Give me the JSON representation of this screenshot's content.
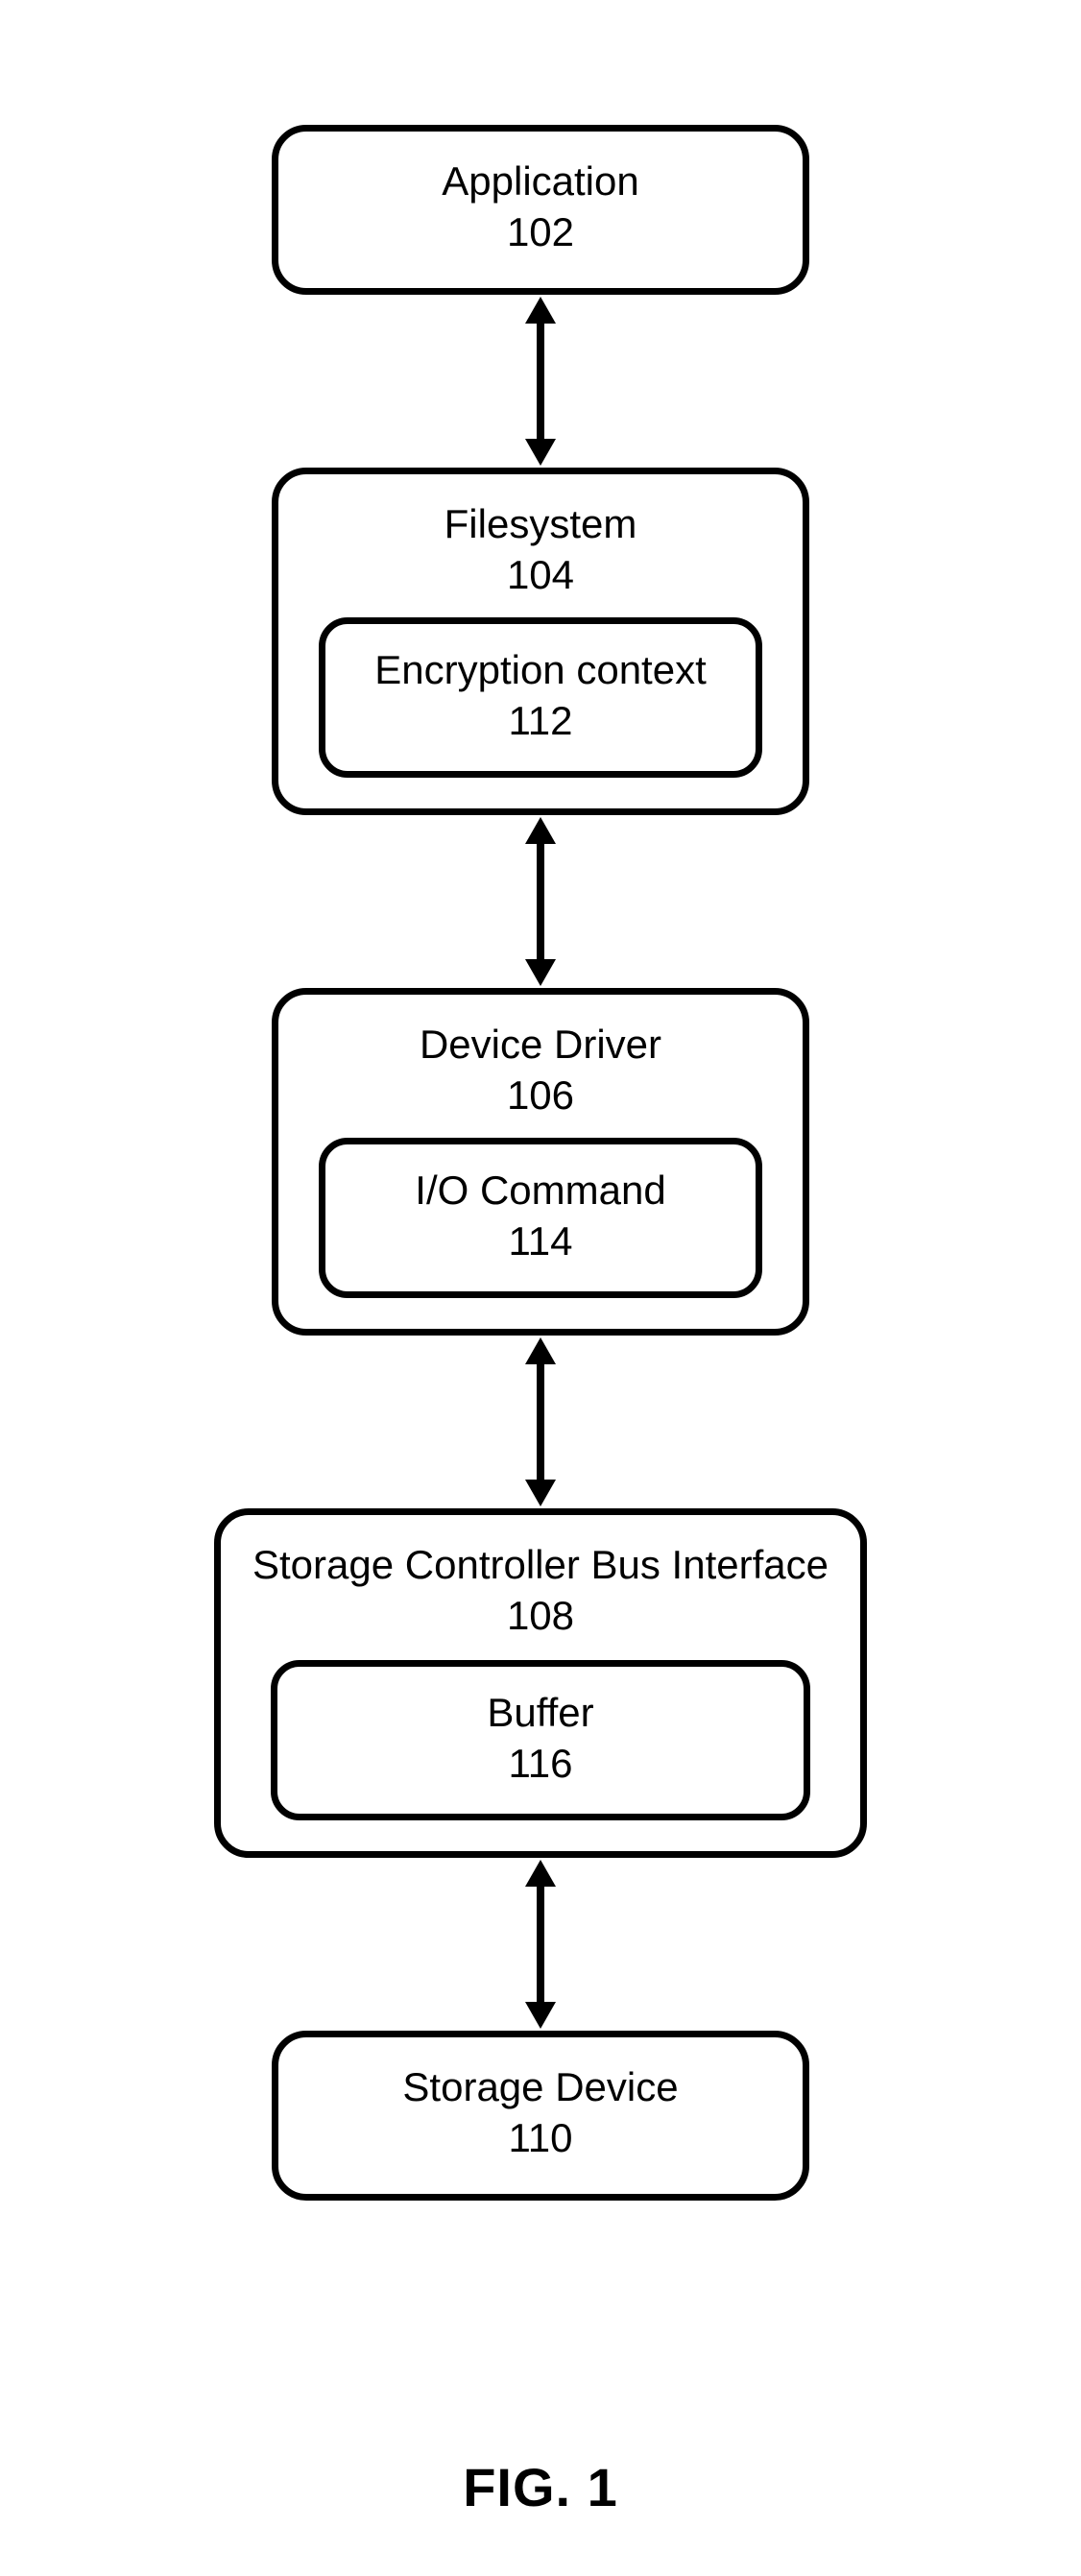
{
  "figure_label": "FIG. 1",
  "blocks": {
    "application": {
      "title": "Application",
      "num": "102"
    },
    "filesystem": {
      "title": "Filesystem",
      "num": "104",
      "inner": {
        "title": "Encryption context",
        "num": "112"
      }
    },
    "device_driver": {
      "title": "Device Driver",
      "num": "106",
      "inner": {
        "title": "I/O Command",
        "num": "114"
      }
    },
    "storage_controller": {
      "title": "Storage Controller Bus Interface",
      "num": "108",
      "inner": {
        "title": "Buffer",
        "num": "116"
      }
    },
    "storage_device": {
      "title": "Storage Device",
      "num": "110"
    }
  }
}
